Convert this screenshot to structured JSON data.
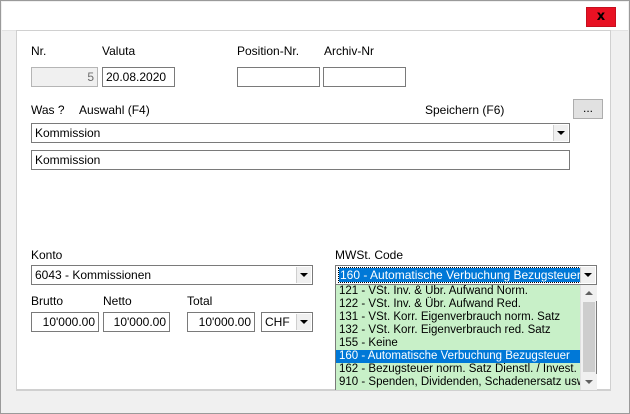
{
  "window": {
    "close_symbol": "x"
  },
  "fields": {
    "nr": {
      "label": "Nr.",
      "value": "5"
    },
    "valuta": {
      "label": "Valuta",
      "value": "20.08.2020"
    },
    "position": {
      "label": "Position-Nr.",
      "value": ""
    },
    "archiv": {
      "label": "Archiv-Nr",
      "value": ""
    }
  },
  "was": {
    "label": "Was ?",
    "auswahl_label": "Auswahl (F4)",
    "speichern_label": "Speichern (F6)",
    "browse_button": "...",
    "combo_value": "Kommission",
    "text_value": "Kommission"
  },
  "konto": {
    "label": "Konto",
    "value": "6043 - Kommissionen"
  },
  "mwst": {
    "label": "MWSt. Code",
    "selected": "160 - Automatische Verbuchung Bezugsteuer",
    "options": [
      "121 - VSt. Inv. & Übr. Aufwand Norm.",
      "122 - VSt. Inv. & Übr. Aufwand Red.",
      "131 - VSt. Korr. Eigenverbrauch norm. Satz",
      "132 - VSt. Korr. Eigenverbrauch red. Satz",
      "155 - Keine",
      "160 - Automatische Verbuchung Bezugsteuer",
      "162 - Bezugsteuer norm. Satz  Dienstl. / Invest.",
      "910 - Spenden, Dividenden, Schadenersatz usw"
    ],
    "selected_index": 5,
    "list_color": "#c8f0c8",
    "highlight_color": "#0078d7"
  },
  "amounts": {
    "brutto": {
      "label": "Brutto",
      "value": "10'000.00"
    },
    "netto": {
      "label": "Netto",
      "value": "10'000.00"
    },
    "total": {
      "label": "Total",
      "value": "10'000.00"
    },
    "currency": "CHF"
  },
  "colors": {
    "close_button": "#e81123"
  }
}
